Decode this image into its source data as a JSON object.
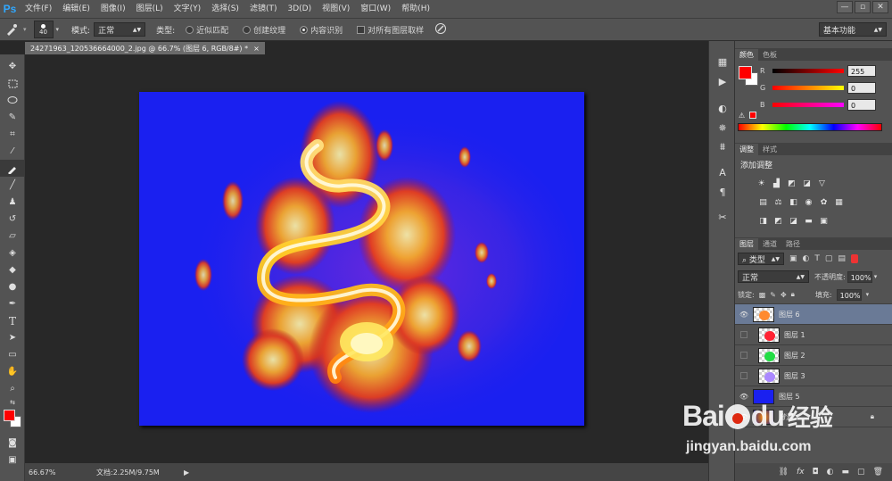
{
  "app": {
    "logo": "Ps"
  },
  "menu": [
    "文件(F)",
    "编辑(E)",
    "图像(I)",
    "图层(L)",
    "文字(Y)",
    "选择(S)",
    "滤镜(T)",
    "3D(D)",
    "视图(V)",
    "窗口(W)",
    "帮助(H)"
  ],
  "window_buttons": [
    "—",
    "▫",
    "✕"
  ],
  "options": {
    "brush_size": "40",
    "mode_label": "模式:",
    "mode_value": "正常",
    "type_label": "类型:",
    "type_options": [
      "近似匹配",
      "创建纹理",
      "内容识别"
    ],
    "sample_all_label": "对所有图层取样",
    "workspace": "基本功能"
  },
  "document_tab": {
    "title": "24271963_120536664000_2.jpg @ 66.7% (图层 6, RGB/8#) *",
    "close": "×"
  },
  "status": {
    "zoom": "66.67%",
    "doc_info": "文档:2.25M/9.75M"
  },
  "color_panel": {
    "tabs": [
      "颜色",
      "色板"
    ],
    "channels": [
      {
        "label": "R",
        "value": "255"
      },
      {
        "label": "G",
        "value": "0"
      },
      {
        "label": "B",
        "value": "0"
      }
    ],
    "foreground": "#ff0000",
    "background": "#ffffff"
  },
  "adjust_panel": {
    "tabs": [
      "调整",
      "样式"
    ],
    "heading": "添加调整"
  },
  "layers_panel": {
    "tabs": [
      "图层",
      "通道",
      "路径"
    ],
    "filter_label": "类型",
    "blend_mode": "正常",
    "opacity_label": "不透明度:",
    "opacity_value": "100%",
    "lock_label": "锁定:",
    "fill_label": "填充:",
    "fill_value": "100%",
    "layers": [
      {
        "name": "图层 6",
        "visible": true,
        "selected": true
      },
      {
        "name": "图层 1",
        "visible": false,
        "selected": false
      },
      {
        "name": "图层 2",
        "visible": false,
        "selected": false
      },
      {
        "name": "图层 3",
        "visible": false,
        "selected": false
      },
      {
        "name": "图层 5",
        "visible": true,
        "selected": false
      },
      {
        "name": "背景",
        "visible": true,
        "selected": false
      }
    ]
  },
  "watermark": {
    "brand_bai": "Bai",
    "brand_du": "du",
    "brand_cn": "经验",
    "url": "jingyan.baidu.com"
  },
  "colors": {
    "canvas_blue": "#1a20f0",
    "ps_blue": "#31a8ff",
    "selected_layer": "#6a7a96",
    "baidu_red": "#de2910"
  }
}
